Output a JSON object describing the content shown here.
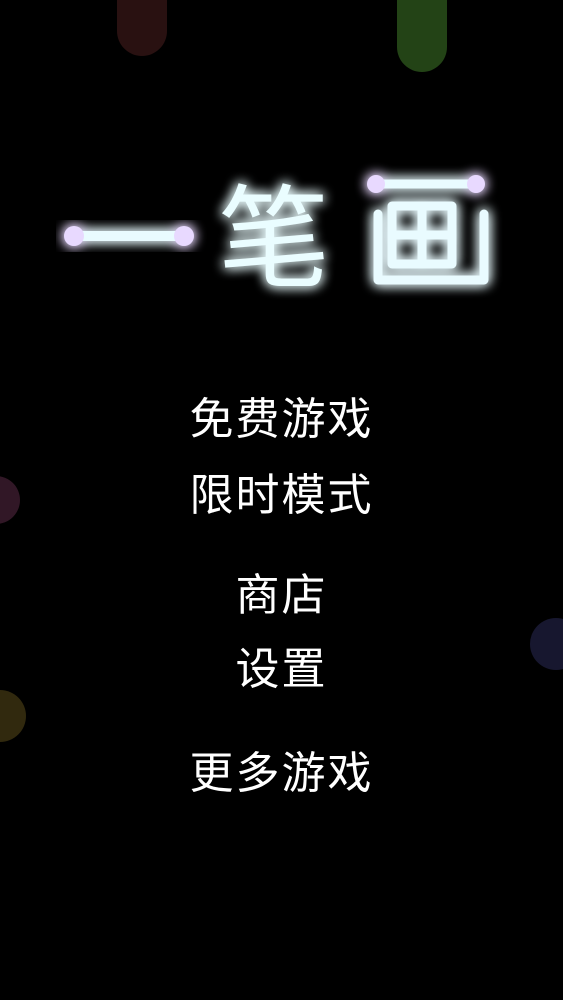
{
  "logo": {
    "title": "一笔画",
    "glow_color": "#3fd8ff",
    "stroke_color": "#e9fbff",
    "dot_color": "#e8d9ff"
  },
  "menu": {
    "free_game": "免费游戏",
    "timed_mode": "限时模式",
    "shop": "商店",
    "settings": "设置",
    "more_games": "更多游戏"
  }
}
